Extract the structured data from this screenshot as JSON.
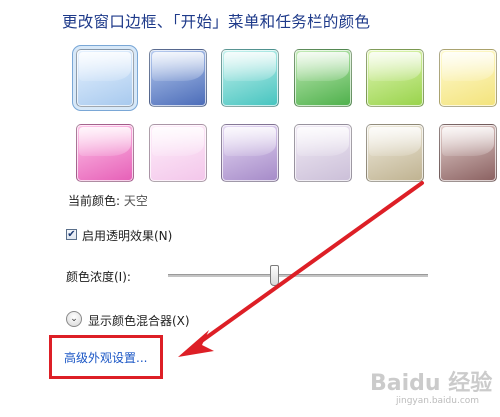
{
  "title": "更改窗口边框、「开始」菜单和任务栏的颜色",
  "swatches_row1": [
    {
      "name": "sky",
      "c1": "#e8f3ff",
      "c2": "#a7c9ee",
      "selected": true
    },
    {
      "name": "twilight",
      "c1": "#b9cdf0",
      "c2": "#4a6bb8",
      "selected": false
    },
    {
      "name": "sea",
      "c1": "#c8f2ee",
      "c2": "#45c4bf",
      "selected": false
    },
    {
      "name": "leaf",
      "c1": "#c5ecb9",
      "c2": "#4db04a",
      "selected": false
    },
    {
      "name": "lime",
      "c1": "#e3f7b9",
      "c2": "#98d34a",
      "selected": false
    },
    {
      "name": "pumpkin",
      "c1": "#fffbd4",
      "c2": "#f3e37b",
      "selected": false
    }
  ],
  "swatches_row2": [
    {
      "name": "fuchsia",
      "c1": "#ffc7ea",
      "c2": "#e65fb7",
      "selected": false
    },
    {
      "name": "blush",
      "c1": "#fff0fb",
      "c2": "#f3c6ea",
      "selected": false
    },
    {
      "name": "violet",
      "c1": "#e7dbf5",
      "c2": "#a58ac8",
      "selected": false
    },
    {
      "name": "lavender",
      "c1": "#f2ecf6",
      "c2": "#cbbfd8",
      "selected": false
    },
    {
      "name": "taupe",
      "c1": "#f1ede0",
      "c2": "#bfb290",
      "selected": false
    },
    {
      "name": "chocolate",
      "c1": "#e6d3d0",
      "c2": "#8a6060",
      "selected": false
    }
  ],
  "current_color": {
    "label": "当前颜色:",
    "value": "天空"
  },
  "transparency": {
    "label": "启用透明效果(N)",
    "checked": true
  },
  "intensity": {
    "label": "颜色浓度(I):",
    "value": 0.41
  },
  "mixer": {
    "label": "显示颜色混合器(X)"
  },
  "advanced_link": "高级外观设置...",
  "watermark": {
    "text": "Baidu 经验",
    "sub": "jingyan.baidu.com"
  },
  "annotation_color": "#dd1f26"
}
